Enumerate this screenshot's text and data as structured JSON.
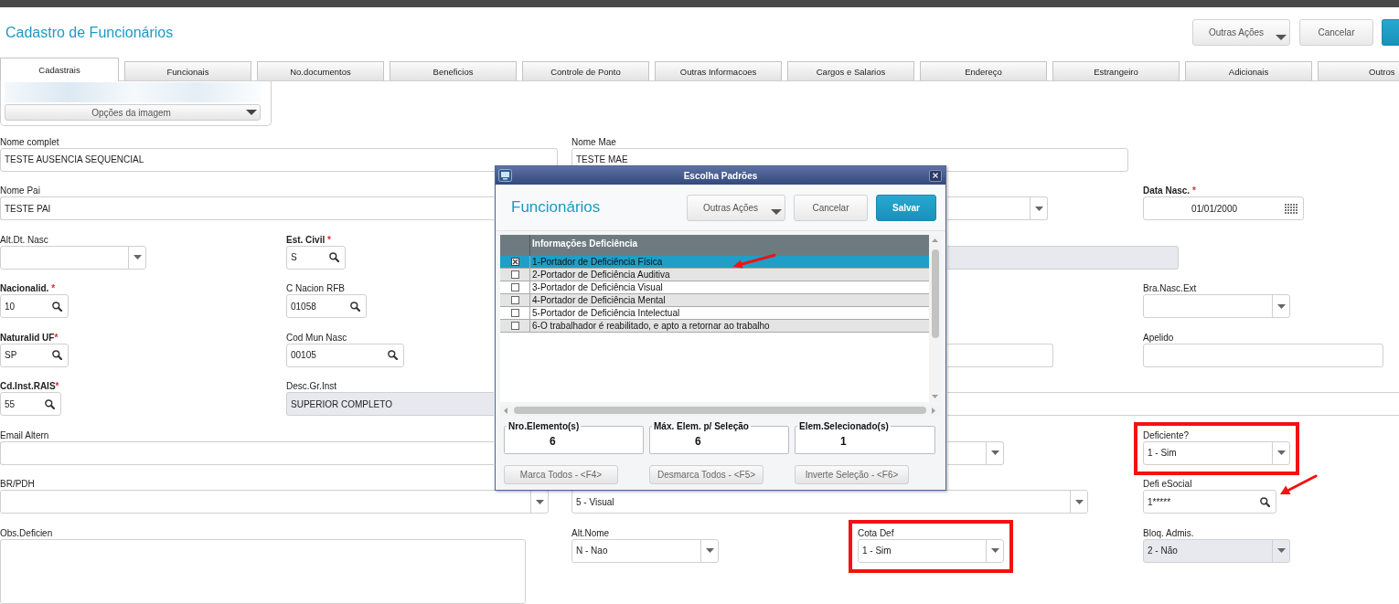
{
  "header": {
    "title": "Cadastro de Funcionários",
    "buttons": [
      {
        "label": "Outras Ações",
        "kind": "menu"
      },
      {
        "label": "Cancelar",
        "kind": "plain"
      },
      {
        "kind": "primary"
      }
    ]
  },
  "tabs": [
    {
      "label": "Cadastrais",
      "selected": true
    },
    {
      "label": "Funcionais",
      "selected": false
    },
    {
      "label": "No.documentos",
      "selected": false
    },
    {
      "label": "Beneficios",
      "selected": false
    },
    {
      "label": "Controle de Ponto",
      "selected": false
    },
    {
      "label": "Outras Informacoes",
      "selected": false
    },
    {
      "label": "Cargos e Salarios",
      "selected": false
    },
    {
      "label": "Endereço",
      "selected": false
    },
    {
      "label": "Estrangeiro",
      "selected": false
    },
    {
      "label": "Adicionais",
      "selected": false
    },
    {
      "label": "Outros",
      "selected": false
    }
  ],
  "image_panel": {
    "button": "Opções da imagem"
  },
  "form_rows": [
    [
      {
        "label": "Nome complet",
        "kind": "text",
        "value": "TESTE AUSENCIA SEQUENCIAL",
        "disabled": false,
        "highlighted": false,
        "pointed": false
      },
      {
        "label": "Nome Mae",
        "kind": "text",
        "value": "TESTE MAE",
        "disabled": false,
        "highlighted": false,
        "pointed": false
      }
    ],
    [
      {
        "label": "Nome Pai",
        "kind": "text",
        "value": "TESTE PAI",
        "disabled": false,
        "highlighted": false,
        "pointed": false
      },
      {
        "kind": "select",
        "disabled": false,
        "highlighted": false,
        "pointed": false
      },
      {
        "label": "Data Nasc.",
        "required_mark": " *",
        "kind": "date",
        "value": "01/01/2000",
        "disabled": false,
        "highlighted": false,
        "pointed": false
      }
    ],
    [
      {
        "label": "Alt.Dt. Nasc",
        "kind": "select",
        "disabled": false,
        "highlighted": false,
        "pointed": false
      },
      {
        "label": "Est. Civil",
        "required_mark": " *",
        "kind": "lookup",
        "value": "S",
        "disabled": false,
        "highlighted": false,
        "pointed": false
      },
      {
        "kind": "text",
        "disabled": true,
        "highlighted": false,
        "pointed": false
      }
    ],
    [
      {
        "label": "Nacionalid.",
        "required_mark": " *",
        "kind": "lookup",
        "value": "10",
        "disabled": false,
        "highlighted": false,
        "pointed": false
      },
      {
        "label": "C Nacion RFB",
        "kind": "lookup",
        "value": "01058",
        "disabled": false,
        "highlighted": false,
        "pointed": false
      },
      {
        "label": "Bra.Nasc.Ext",
        "kind": "select",
        "disabled": false,
        "highlighted": false,
        "pointed": false
      }
    ],
    [
      {
        "label": "Naturalid UF",
        "required_mark": "*",
        "kind": "lookup",
        "value": "SP",
        "disabled": false,
        "highlighted": false,
        "pointed": false
      },
      {
        "label": "Cod Mun Nasc",
        "kind": "lookup",
        "value": "00105",
        "disabled": false,
        "highlighted": false,
        "pointed": false
      },
      {
        "kind": "text",
        "disabled": false,
        "highlighted": false,
        "pointed": false
      },
      {
        "label": "Apelido",
        "kind": "text",
        "disabled": false,
        "highlighted": false,
        "pointed": false
      }
    ],
    [
      {
        "label": "Cd.Inst.RAIS",
        "required_mark": "*",
        "kind": "lookup",
        "value": "55",
        "disabled": false,
        "highlighted": false,
        "pointed": false
      },
      {
        "label": "Desc.Gr.Inst",
        "kind": "text",
        "value": "SUPERIOR COMPLETO",
        "disabled": true,
        "highlighted": false,
        "pointed": false
      },
      {
        "kind": "text",
        "disabled": false,
        "highlighted": false,
        "pointed": false
      }
    ],
    [
      {
        "label": "Email Altern",
        "kind": "text",
        "disabled": false,
        "highlighted": false,
        "pointed": false
      },
      {
        "kind": "select",
        "disabled": false,
        "highlighted": false,
        "pointed": false
      },
      {
        "label": "Deficiente?",
        "kind": "select",
        "value": "1 - Sim",
        "disabled": false,
        "highlighted": true,
        "pointed": false
      }
    ],
    [
      {
        "label": "BR/PDH",
        "kind": "select",
        "disabled": false,
        "highlighted": false,
        "pointed": false
      },
      {
        "kind": "select",
        "value": "5 - Visual",
        "disabled": false,
        "highlighted": false,
        "pointed": false
      },
      {
        "label": "Defi eSocial",
        "kind": "lookup",
        "value": "1*****",
        "disabled": false,
        "highlighted": false,
        "pointed": true
      }
    ],
    [
      {
        "label": "Obs.Deficien",
        "kind": "textarea",
        "disabled": false,
        "highlighted": false,
        "pointed": false
      },
      {
        "label": "Alt.Nome",
        "kind": "select",
        "value": "N - Nao",
        "disabled": false,
        "highlighted": false,
        "pointed": false
      },
      {
        "label": "Cota Def",
        "kind": "select",
        "value": "1 - Sim",
        "disabled": false,
        "highlighted": true,
        "pointed": false
      },
      {
        "label": "Bloq. Admis.",
        "kind": "select",
        "value": "2 - Não",
        "disabled": true,
        "highlighted": false,
        "pointed": false
      }
    ]
  ],
  "dialog": {
    "title": "Escolha Padrões",
    "heading": "Funcionários",
    "buttons": [
      {
        "label": "Outras Ações",
        "kind": "menu"
      },
      {
        "label": "Cancelar",
        "kind": "plain"
      },
      {
        "label": "Salvar",
        "kind": "primary"
      }
    ],
    "list": {
      "column": "Informações Deficiência",
      "rows": [
        {
          "label": "1-Portador de Deficiência Física",
          "checked": true,
          "selected": true,
          "pointed": true
        },
        {
          "label": "2-Portador de Deficiência Auditiva",
          "checked": false,
          "selected": false,
          "pointed": false
        },
        {
          "label": "3-Portador de Deficiência Visual",
          "checked": false,
          "selected": false,
          "pointed": false
        },
        {
          "label": "4-Portador de Deficiência Mental",
          "checked": false,
          "selected": false,
          "pointed": false
        },
        {
          "label": "5-Portador de Deficiência Intelectual",
          "checked": false,
          "selected": false,
          "pointed": false
        },
        {
          "label": "6-O trabalhador é reabilitado, e apto a retornar ao trabalho",
          "checked": false,
          "selected": false,
          "pointed": false
        }
      ]
    },
    "counters": [
      {
        "label": "Nro.Elemento(s)",
        "value": "6"
      },
      {
        "label": "Máx. Elem. p/ Seleção",
        "value": "6"
      },
      {
        "label": "Elem.Selecionado(s)",
        "value": "1"
      }
    ],
    "actions": [
      "Marca Todos - <F4>",
      "Desmarca Todos - <F5>",
      "Inverte Seleção - <F6>"
    ]
  }
}
